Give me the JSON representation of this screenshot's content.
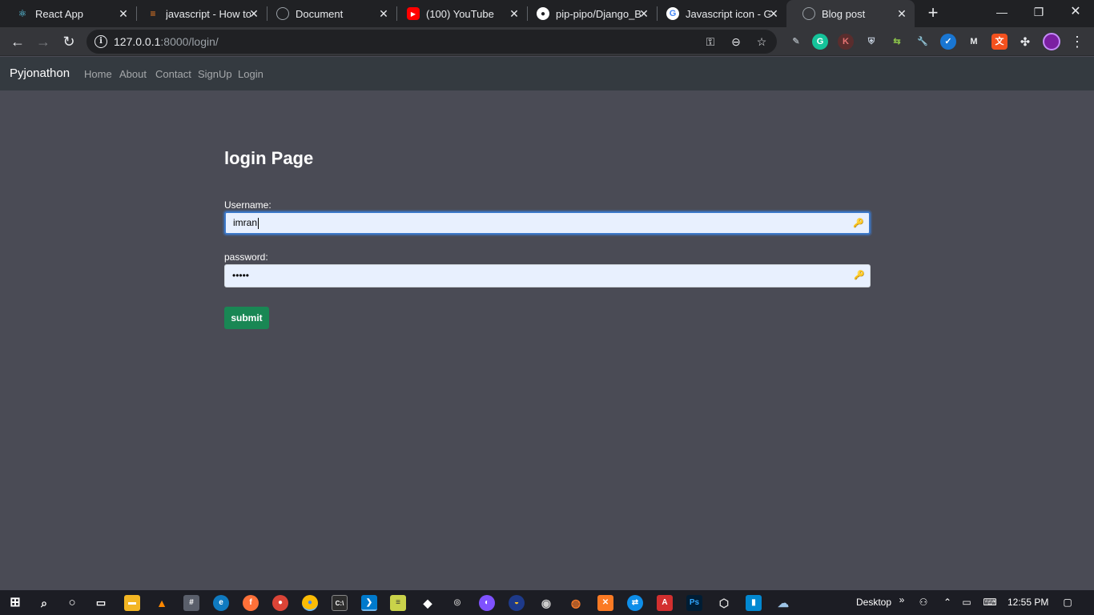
{
  "browser": {
    "tabs": [
      {
        "title": "React App",
        "icon": "react-icon",
        "color": "#61dafb"
      },
      {
        "title": "javascript - How to",
        "icon": "stackoverflow-icon",
        "color": "#f48024"
      },
      {
        "title": "Document",
        "icon": "globe-icon",
        "color": "#9aa0a6"
      },
      {
        "title": "(100) YouTube",
        "icon": "youtube-icon",
        "color": "#ff0000"
      },
      {
        "title": "pip-pipo/Django_B",
        "icon": "github-icon",
        "color": "#ffffff"
      },
      {
        "title": "Javascript icon - G",
        "icon": "google-icon",
        "color": "#4285f4"
      },
      {
        "title": "Blog post",
        "icon": "globe-icon",
        "color": "#9aa0a6",
        "active": true
      }
    ],
    "address": {
      "host": "127.0.0.1",
      "path": ":8000/login/"
    }
  },
  "navbar": {
    "brand": "Pyjonathon",
    "links": [
      "Home",
      "About",
      "Contact",
      "SignUp",
      "Login"
    ]
  },
  "form": {
    "heading": "login Page",
    "username_label": "Username:",
    "username_value": "imran",
    "password_label": "password:",
    "password_value": "•••••",
    "submit_label": "submit"
  },
  "taskbar": {
    "desktop_label": "Desktop",
    "time": "12:55 PM"
  },
  "colors": {
    "page_bg": "#4a4b55",
    "navbar_bg": "#343a40",
    "submit_bg": "#198754",
    "focus_border": "#3b78c9"
  }
}
